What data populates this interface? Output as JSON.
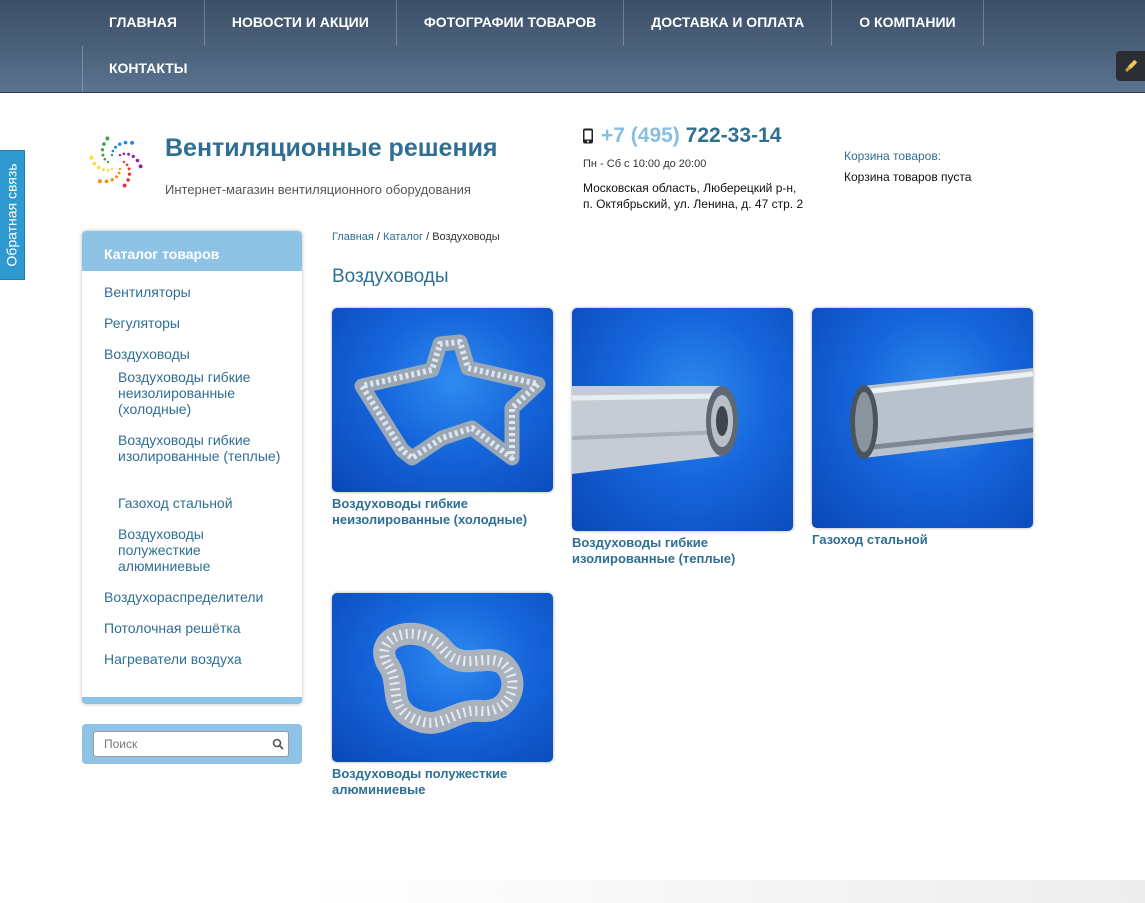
{
  "nav": {
    "items": [
      "ГЛАВНАЯ",
      "НОВОСТИ И АКЦИИ",
      "ФОТОГРАФИИ ТОВАРОВ",
      "ДОСТАВКА И ОПЛАТА",
      "О КОМПАНИИ",
      "КОНТАКТЫ"
    ]
  },
  "feedback": {
    "label": "Обратная связь"
  },
  "header": {
    "title": "Вентиляционные решения",
    "subtitle": "Интернет-магазин вентиляционного оборудования",
    "phone_code": "+7 (495)",
    "phone_number": "722-33-14",
    "hours": "Пн - Сб с 10:00 до 20:00",
    "address_line1": "Московская область, Люберецкий р-н,",
    "address_line2": "п. Октябрьский, ул. Ленина, д. 47 стр. 2",
    "cart_label": "Корзина товаров:",
    "cart_status": "Корзина товаров пуста"
  },
  "catalog": {
    "title": "Каталог товаров",
    "items": [
      "Вентиляторы",
      "Регуляторы",
      "Воздуховоды"
    ],
    "subitems": [
      "Воздуховоды гибкие неизолированные (холодные)",
      "Воздуховоды гибкие изолированные (теплые)",
      "Газоход стальной",
      "Воздуховоды полужесткие алюминиевые"
    ],
    "items_after": [
      "Воздухораспределители",
      "Потолочная решётка",
      "Нагреватели воздуха"
    ]
  },
  "search": {
    "placeholder": "Поиск"
  },
  "breadcrumb": {
    "home": "Главная",
    "catalog": "Каталог",
    "current": "Воздуховоды",
    "sep": " / "
  },
  "page": {
    "title": "Воздуховоды"
  },
  "products": [
    {
      "name": "Воздуховоды гибкие неизолированные (холодные)"
    },
    {
      "name": "Воздуховоды гибкие изолированные (теплые)"
    },
    {
      "name": "Газоход стальной"
    },
    {
      "name": "Воздуховоды полужесткие алюминиевые"
    }
  ],
  "colors": {
    "accent": "#2f6f93",
    "light_blue": "#8ec3e6",
    "nav_bg": "#4a6079",
    "feedback": "#2e9ad0"
  },
  "icons": [
    "tool-icon",
    "phone-icon",
    "search-icon",
    "logo-icon"
  ]
}
